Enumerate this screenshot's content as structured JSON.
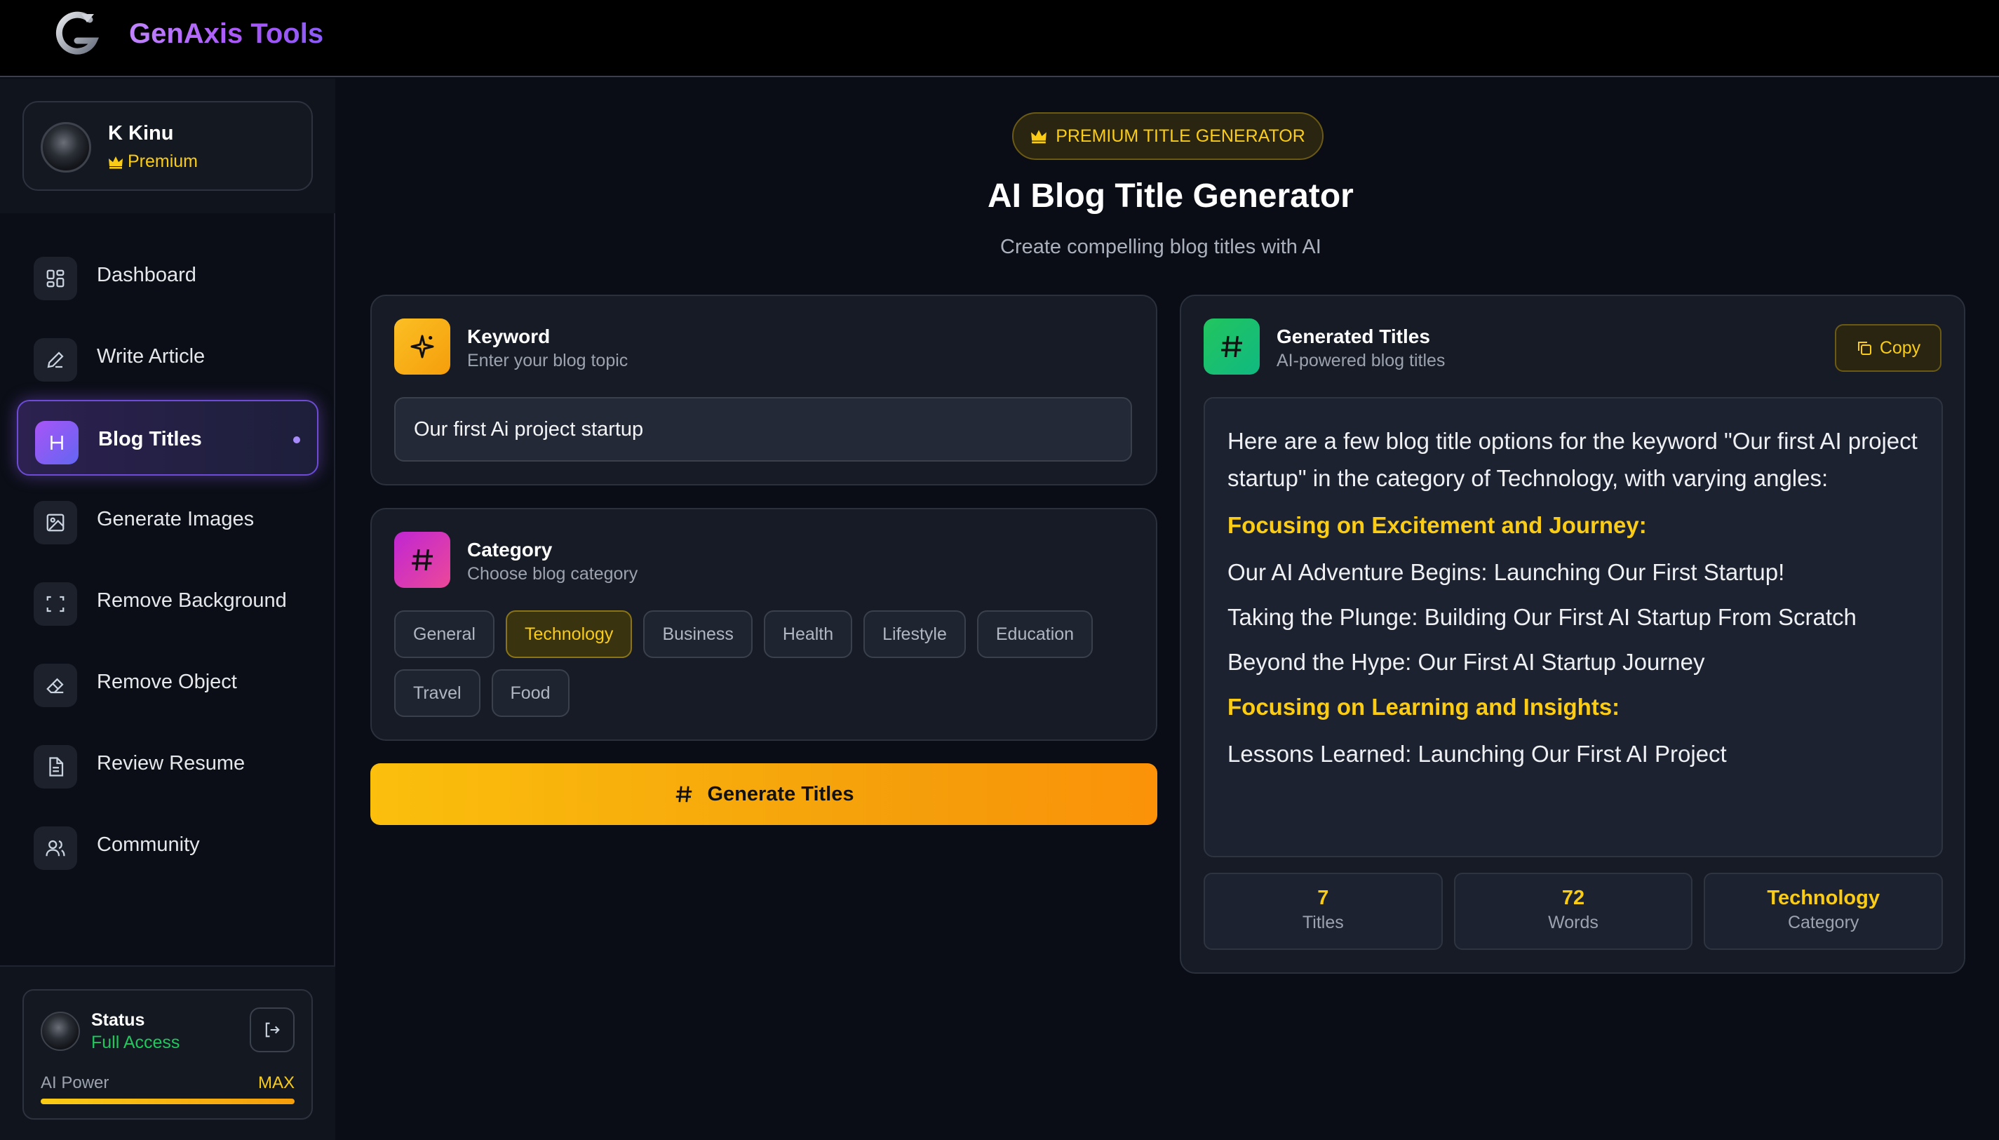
{
  "app": {
    "brand": "GenAxis Tools"
  },
  "user": {
    "name": "K Kinu",
    "plan": "Premium"
  },
  "nav": [
    {
      "label": "Dashboard",
      "icon": "dashboard-icon"
    },
    {
      "label": "Write Article",
      "icon": "pen-icon"
    },
    {
      "label": "Blog Titles",
      "icon": "heading-icon",
      "active": true
    },
    {
      "label": "Generate Images",
      "icon": "image-icon"
    },
    {
      "label": "Remove Background",
      "icon": "crop-icon"
    },
    {
      "label": "Remove Object",
      "icon": "eraser-icon"
    },
    {
      "label": "Review Resume",
      "icon": "document-icon"
    },
    {
      "label": "Community",
      "icon": "users-icon"
    }
  ],
  "status": {
    "title": "Status",
    "access": "Full Access",
    "power_label": "AI Power",
    "power_value": "MAX",
    "power_fraction": 1.0
  },
  "header": {
    "badge": "PREMIUM TITLE GENERATOR",
    "title": "AI Blog Title Generator",
    "subtitle": "Create compelling blog titles with AI"
  },
  "keyword": {
    "title": "Keyword",
    "subtitle": "Enter your blog topic",
    "value": "Our first Ai project startup"
  },
  "category": {
    "title": "Category",
    "subtitle": "Choose blog category",
    "options": [
      "General",
      "Technology",
      "Business",
      "Health",
      "Lifestyle",
      "Education",
      "Travel",
      "Food"
    ],
    "selected": "Technology"
  },
  "generate_button": "Generate Titles",
  "results": {
    "title": "Generated Titles",
    "subtitle": "AI-powered blog titles",
    "copy_label": "Copy",
    "intro": "Here are a few blog title options for the keyword \"Our first AI project startup\" in the category of Technology, with varying angles:",
    "heading1": "Focusing on Excitement and Journey:",
    "line1": "Our AI Adventure Begins: Launching Our First Startup!",
    "line2": "Taking the Plunge: Building Our First AI Startup From Scratch",
    "line3": "Beyond the Hype: Our First AI Startup Journey",
    "heading2": "Focusing on Learning and Insights:",
    "line4": "Lessons Learned: Launching Our First AI Project"
  },
  "stats": [
    {
      "value": "7",
      "label": "Titles"
    },
    {
      "value": "72",
      "label": "Words"
    },
    {
      "value": "Technology",
      "label": "Category"
    }
  ],
  "colors": {
    "accent_yellow": "#facc15",
    "accent_purple": "#a855f7",
    "success_green": "#22c55e",
    "background": "#0a0d15"
  }
}
